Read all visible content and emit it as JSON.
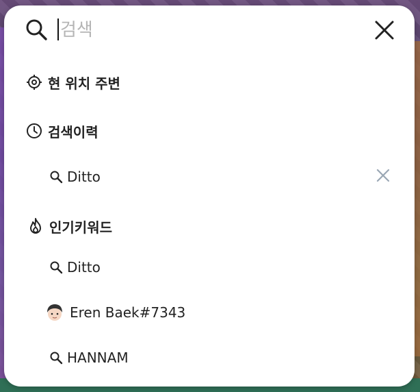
{
  "search": {
    "placeholder": "검색",
    "value": ""
  },
  "sections": {
    "nearby": {
      "label": "현 위치 주변",
      "icon": "location-target-icon"
    },
    "history": {
      "label": "검색이력",
      "icon": "clock-icon",
      "items": [
        {
          "label": "Ditto",
          "icon": "search-icon"
        }
      ]
    },
    "popular": {
      "label": "인기키워드",
      "icon": "fire-icon",
      "items": [
        {
          "label": "Ditto",
          "icon": "search-icon"
        },
        {
          "label": "Eren Baek#7343",
          "icon": "avatar"
        },
        {
          "label": "HANNAM",
          "icon": "search-icon"
        }
      ]
    }
  },
  "colors": {
    "panel_bg": "#ffffff",
    "text": "#222222",
    "placeholder": "#b5b5b5",
    "remove_x": "#9aa7b4"
  }
}
